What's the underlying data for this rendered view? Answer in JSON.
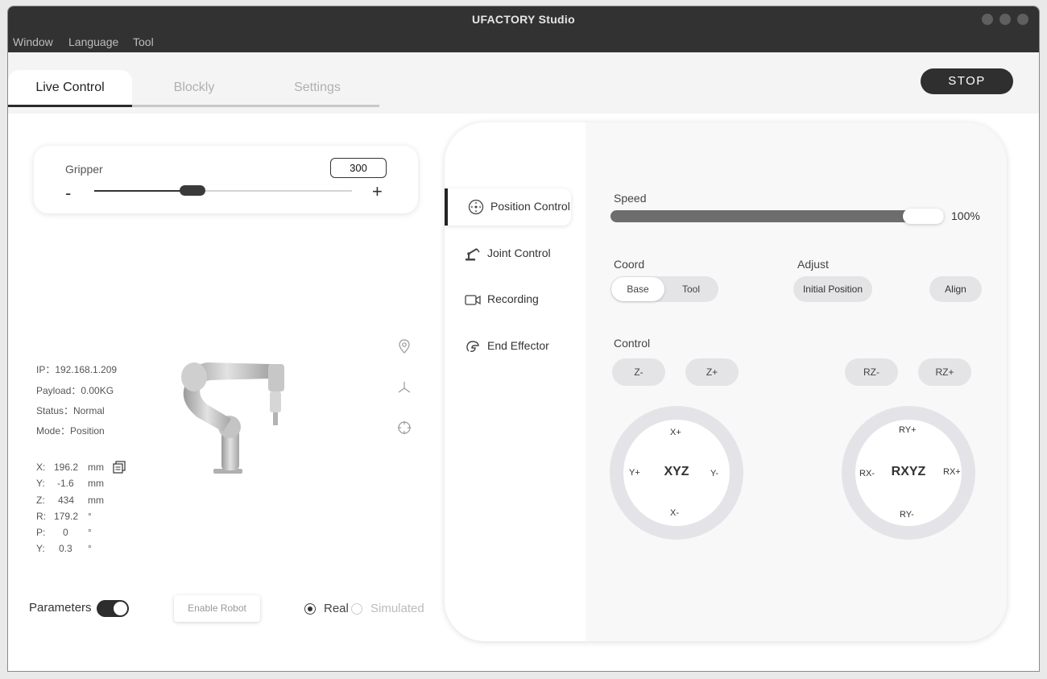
{
  "window": {
    "title": "UFACTORY Studio"
  },
  "menu": [
    "Window",
    "Language",
    "Tool"
  ],
  "tabs": [
    "Live Control",
    "Blockly",
    "Settings"
  ],
  "stop_label": "STOP",
  "gripper": {
    "label": "Gripper",
    "value": "300",
    "minus": "-",
    "plus": "+",
    "position": 0.38
  },
  "robot_info": {
    "ip": "IP：192.168.1.209",
    "payload": "Payload：0.00KG",
    "status": "Status：Normal",
    "mode": "Mode：Position"
  },
  "pose": [
    {
      "axis": "X:",
      "value": "196.2",
      "unit": "mm"
    },
    {
      "axis": "Y:",
      "value": "-1.6",
      "unit": "mm"
    },
    {
      "axis": "Z:",
      "value": "434",
      "unit": "mm"
    },
    {
      "axis": "R:",
      "value": "179.2",
      "unit": "°"
    },
    {
      "axis": "P:",
      "value": "0",
      "unit": "°"
    },
    {
      "axis": "Y:",
      "value": "0.3",
      "unit": "°"
    }
  ],
  "bottom": {
    "parameters_label": "Parameters",
    "parameters_on": true,
    "enable_label": "Enable Robot",
    "real_label": "Real",
    "simulated_label": "Simulated"
  },
  "nav": [
    "Position Control",
    "Joint Control",
    "Recording",
    "End Effector"
  ],
  "control": {
    "speed_label": "Speed",
    "speed_value": "100%",
    "coord_label": "Coord",
    "coord_options": [
      "Base",
      "Tool"
    ],
    "adjust_label": "Adjust",
    "initial_position": "Initial Position",
    "align": "Align",
    "control_label": "Control",
    "jog": [
      "Z-",
      "Z+",
      "RZ-",
      "RZ+"
    ],
    "xyz": {
      "center": "XYZ",
      "top": "X+",
      "bottom": "X-",
      "left": "Y+",
      "right": "Y-"
    },
    "rxyz": {
      "center": "RXYZ",
      "top": "RY+",
      "bottom": "RY-",
      "left": "RX-",
      "right": "RX+"
    }
  }
}
